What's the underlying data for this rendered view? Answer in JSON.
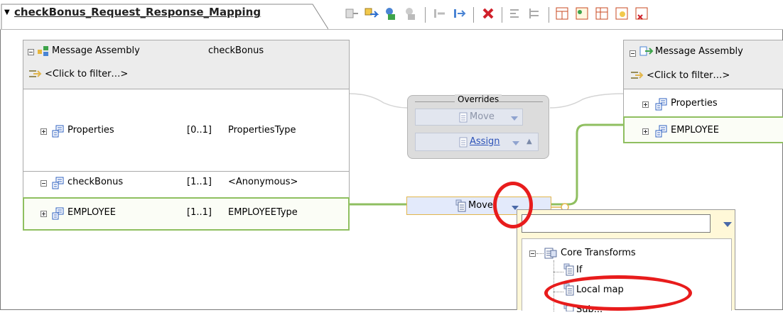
{
  "editor": {
    "title": "checkBonus_Request_Response_Mapping",
    "toolbar_icons": [
      "merge-icon",
      "connect-icon",
      "add-source-icon",
      "remove-source-icon",
      "move-left-icon",
      "move-right-icon",
      "delete-icon",
      "collapse-icon",
      "expand-icon",
      "table-icon",
      "grid-icon",
      "grid-add-icon",
      "grid-edit-icon",
      "grid-delete-icon"
    ]
  },
  "source": {
    "header_title": "Message Assembly",
    "header_name": "checkBonus",
    "filter": "<Click to filter…>",
    "rows": [
      {
        "name": "Properties",
        "cardinality": "[0..1]",
        "type": "PropertiesType"
      },
      {
        "name": "checkBonus",
        "cardinality": "[1..1]",
        "type": "<Anonymous>"
      },
      {
        "name": "EMPLOYEE",
        "cardinality": "[1..1]",
        "type": "EMPLOYEEType"
      }
    ]
  },
  "overrides": {
    "label": "Overrides",
    "move": "Move",
    "assign": "Assign"
  },
  "transform": {
    "move": "Move"
  },
  "target": {
    "header_title": "Message Assembly",
    "filter": "<Click to filter…>",
    "rows": [
      {
        "name": "Properties"
      },
      {
        "name": "EMPLOYEE"
      }
    ]
  },
  "popup": {
    "search_value": "",
    "group": "Core Transforms",
    "items": [
      "If",
      "Local map",
      "Sub..."
    ]
  },
  "colors": {
    "link_green": "#8fbf60",
    "highlight_red": "#e81c1c",
    "panel_border": "#a9a9a9"
  }
}
